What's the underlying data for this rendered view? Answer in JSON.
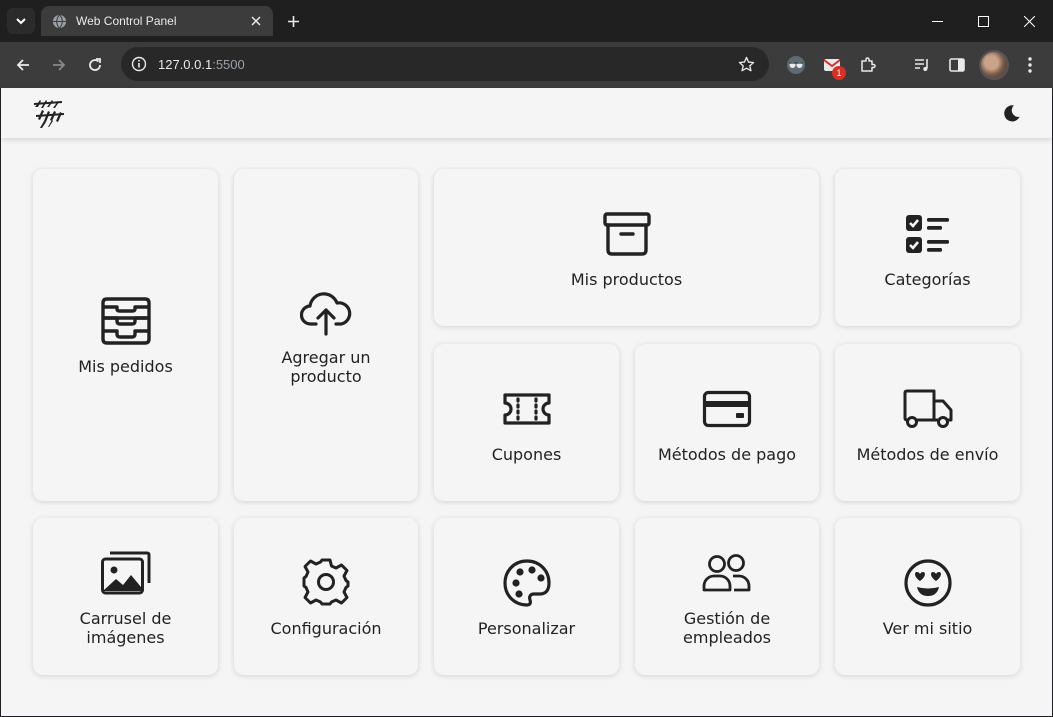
{
  "browser": {
    "tab_title": "Web Control Panel",
    "url_host": "127.0.0.1",
    "url_port": ":5500",
    "extension_badge": "1"
  },
  "panel": {
    "cards": {
      "orders": "Mis pedidos",
      "add_product": "Agregar un producto",
      "products": "Mis productos",
      "categories": "Categorías",
      "coupons": "Cupones",
      "payment": "Métodos de pago",
      "shipping": "Métodos de envío",
      "carousel": "Carrusel de imágenes",
      "settings": "Configuración",
      "customize": "Personalizar",
      "employees": "Gestión de empleados",
      "view_site": "Ver mi sitio"
    }
  },
  "icons": {
    "orders": "inbox-stack-icon",
    "add_product": "cloud-upload-icon",
    "products": "archive-box-icon",
    "categories": "checklist-icon",
    "coupons": "ticket-icon",
    "payment": "credit-card-icon",
    "shipping": "truck-icon",
    "carousel": "images-icon",
    "settings": "gear-icon",
    "customize": "palette-icon",
    "employees": "users-icon",
    "view_site": "heart-eyes-icon",
    "theme": "moon-icon"
  },
  "colors": {
    "page_bg": "#f5f5f5",
    "card_bg": "#f5f5f5",
    "icon": "#222222",
    "browser_frame": "#1f1f1f",
    "browser_toolbar": "#3c3c3c"
  }
}
